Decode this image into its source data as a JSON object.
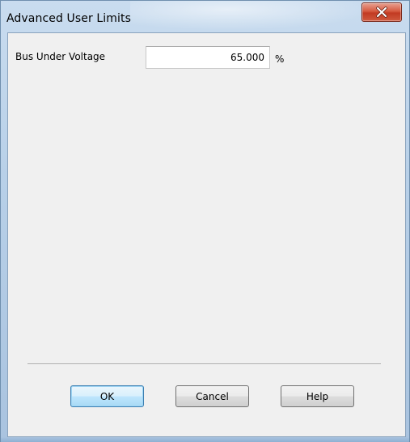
{
  "window": {
    "title": "Advanced User Limits",
    "close_symbol": "X"
  },
  "form": {
    "bus_under_voltage": {
      "label": "Bus Under Voltage",
      "value": "65.000",
      "unit": "%"
    }
  },
  "buttons": {
    "ok": "OK",
    "cancel": "Cancel",
    "help": "Help"
  },
  "icons": {
    "close": "close-icon"
  },
  "colors": {
    "frame": "#b8d0e8",
    "client_background": "#f0f0f0",
    "close_button": "#c23a22",
    "default_button_border": "#3c7fb1"
  }
}
